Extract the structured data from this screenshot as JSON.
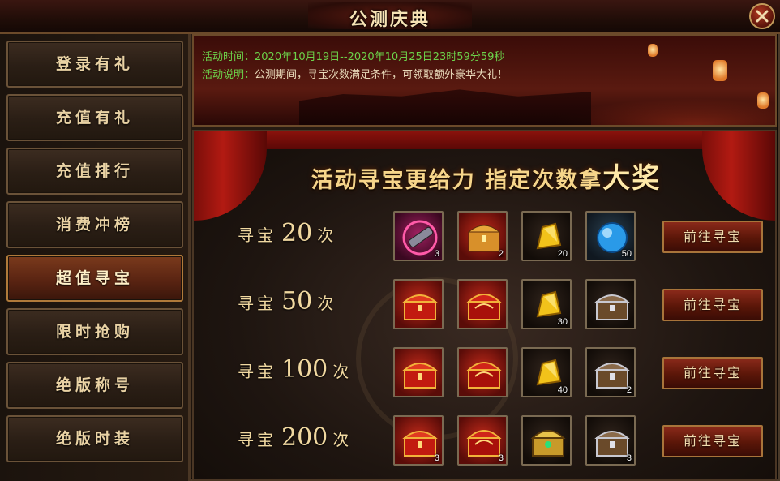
{
  "window": {
    "title": "公测庆典"
  },
  "sidebar": {
    "items": [
      {
        "label": "登录有礼"
      },
      {
        "label": "充值有礼"
      },
      {
        "label": "充值排行"
      },
      {
        "label": "消费冲榜"
      },
      {
        "label": "超值寻宝"
      },
      {
        "label": "限时抢购"
      },
      {
        "label": "绝版称号"
      },
      {
        "label": "绝版时装"
      }
    ],
    "active_label": "超值寻宝"
  },
  "banner": {
    "time_label": "活动时间：",
    "time_value": "2020年10月19日--2020年10月25日23时59分59秒",
    "desc_label": "活动说明：",
    "desc_value": "公测期间，寻宝次数满足条件，可领取额外豪华大礼！"
  },
  "main": {
    "headline_part1": "活动寻宝更给力  指定次数拿",
    "headline_part2": "大奖",
    "rows": [
      {
        "word": "寻宝",
        "count": "20",
        "unit": "次",
        "button": "前往寻宝",
        "rewards": [
          {
            "icon": "cannon-icon",
            "qty": "3"
          },
          {
            "icon": "treasure-chest-icon",
            "qty": "2"
          },
          {
            "icon": "gold-ingot-icon",
            "qty": "20"
          },
          {
            "icon": "blue-orb-icon",
            "qty": "50"
          }
        ]
      },
      {
        "word": "寻宝",
        "count": "50",
        "unit": "次",
        "button": "前往寻宝",
        "rewards": [
          {
            "icon": "red-chest-icon",
            "qty": ""
          },
          {
            "icon": "red-ornate-chest-icon",
            "qty": ""
          },
          {
            "icon": "gold-ingot-icon",
            "qty": "30"
          },
          {
            "icon": "silver-chest-icon",
            "qty": ""
          }
        ]
      },
      {
        "word": "寻宝",
        "count": "100",
        "unit": "次",
        "button": "前往寻宝",
        "rewards": [
          {
            "icon": "red-chest-icon",
            "qty": ""
          },
          {
            "icon": "red-ornate-chest-icon",
            "qty": ""
          },
          {
            "icon": "gold-ingot-icon",
            "qty": "40"
          },
          {
            "icon": "silver-chest-icon",
            "qty": "2"
          }
        ]
      },
      {
        "word": "寻宝",
        "count": "200",
        "unit": "次",
        "button": "前往寻宝",
        "rewards": [
          {
            "icon": "red-chest-icon",
            "qty": "3"
          },
          {
            "icon": "red-ornate-chest-icon",
            "qty": "3"
          },
          {
            "icon": "golden-chest-icon",
            "qty": ""
          },
          {
            "icon": "silver-chest-icon",
            "qty": "3"
          }
        ]
      }
    ]
  },
  "colors": {
    "accent_gold": "#f6d58a",
    "info_green": "#6cd24a",
    "button_red": "#8a2a1a"
  }
}
